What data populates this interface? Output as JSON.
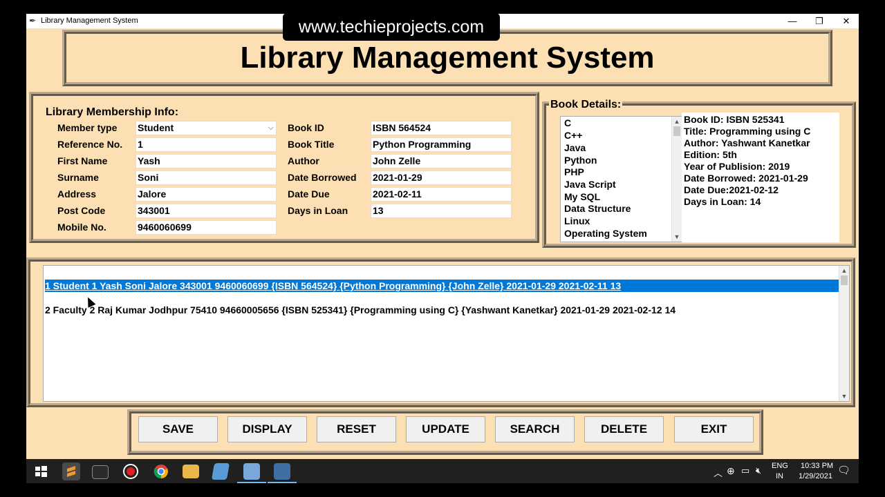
{
  "window": {
    "title": "Library Management System",
    "minimize": "—",
    "restore": "❐",
    "close": "✕"
  },
  "watermark": "www.techieprojects.com",
  "header": {
    "title": "Library Management System"
  },
  "membership": {
    "group_label": "Library Membership Info:",
    "fields": [
      {
        "label": "Member type",
        "value": "Student"
      },
      {
        "label": "Reference No.",
        "value": "1"
      },
      {
        "label": "First Name",
        "value": "Yash"
      },
      {
        "label": "Surname",
        "value": "Soni"
      },
      {
        "label": "Address",
        "value": "Jalore"
      },
      {
        "label": "Post Code",
        "value": "343001"
      },
      {
        "label": "Mobile No.",
        "value": "9460060699"
      }
    ],
    "book_fields": [
      {
        "label": "Book ID",
        "value": "ISBN 564524"
      },
      {
        "label": "Book Title",
        "value": "Python Programming"
      },
      {
        "label": "Author",
        "value": "John Zelle"
      },
      {
        "label": "Date Borrowed",
        "value": "2021-01-29"
      },
      {
        "label": "Date Due",
        "value": "2021-02-11"
      },
      {
        "label": "Days in Loan",
        "value": "13"
      }
    ]
  },
  "book_details": {
    "group_label": "Book Details:",
    "list": [
      "C",
      "C++",
      "Java",
      "Python",
      "PHP",
      "Java Script",
      "My SQL",
      "Data Structure",
      "Linux",
      "Operating System"
    ],
    "info": [
      "Book ID: ISBN 525341",
      "Title: Programming using C",
      "Author:  Yashwant Kanetkar",
      "Edition: 5th",
      "Year of Publision:  2019",
      "Date Borrowed: 2021-01-29",
      "Date Due:2021-02-12",
      "Days in Loan: 14"
    ]
  },
  "records": [
    "1 Student 1 Yash Soni Jalore 343001 9460060699 {ISBN 564524} {Python Programming} {John Zelle} 2021-01-29 2021-02-11 13",
    "2 Faculty 2 Raj Kumar Jodhpur 75410 94660005656 {ISBN 525341} {Programming using C} {Yashwant Kanetkar} 2021-01-29 2021-02-12 14"
  ],
  "buttons": [
    "SAVE",
    "DISPLAY",
    "RESET",
    "UPDATE",
    "SEARCH",
    "DELETE",
    "EXIT"
  ],
  "tray": {
    "lang1": "ENG",
    "lang2": "IN",
    "time": "10:33 PM",
    "date": "1/29/2021"
  },
  "colors": {
    "background": "#fce0b3",
    "selection": "#0078d7"
  }
}
